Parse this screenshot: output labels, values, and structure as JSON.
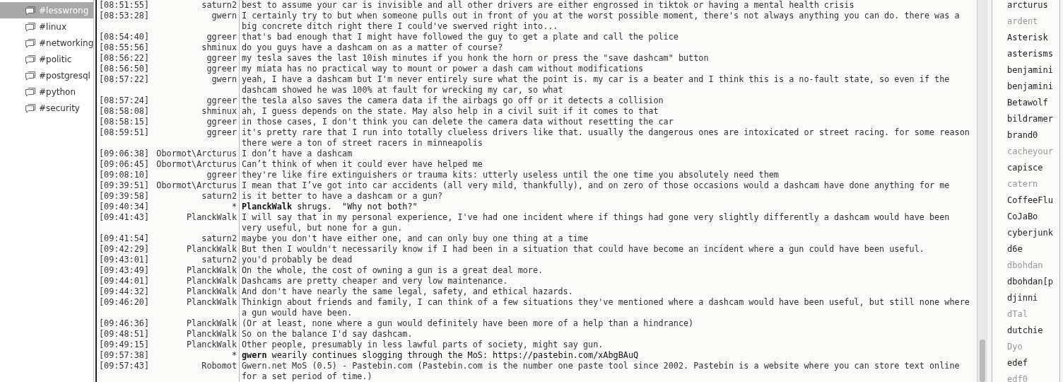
{
  "channels": [
    {
      "label": "#lesswrong",
      "selected": true
    },
    {
      "label": "#linux",
      "selected": false
    },
    {
      "label": "#networking",
      "selected": false
    },
    {
      "label": "#politic",
      "selected": false
    },
    {
      "label": "#postgresql",
      "selected": false
    },
    {
      "label": "#python",
      "selected": false
    },
    {
      "label": "#security",
      "selected": false
    }
  ],
  "messages": [
    {
      "kind": "message",
      "time": "[08:51:55]",
      "nick": "saturn2",
      "text": "best to assume your car is invisible and all other drivers are either engrossed in tiktok or having a mental health crisis"
    },
    {
      "kind": "message",
      "time": "[08:53:28]",
      "nick": "gwern",
      "text": "I certainly try to but when someone pulls out in front of you at the worst possible moment, there's not always anything you can do. there was a big concrete ditch right there I could've swerved right into..."
    },
    {
      "kind": "message",
      "time": "[08:54:40]",
      "nick": "ggreer",
      "text": "that's bad enough that I might have followed the guy to get a plate and call the police"
    },
    {
      "kind": "message",
      "time": "[08:55:56]",
      "nick": "shminux",
      "text": "do you guys have a dashcam on as a matter of course?"
    },
    {
      "kind": "message",
      "time": "[08:56:22]",
      "nick": "ggreer",
      "text": "my tesla saves the last 10ish minutes if you honk the horn or press the \"save dashcam\" button"
    },
    {
      "kind": "message",
      "time": "[08:56:50]",
      "nick": "ggreer",
      "text": "my miata has no practical way to mount or power a dash cam without modifications"
    },
    {
      "kind": "message",
      "time": "[08:57:22]",
      "nick": "gwern",
      "text": "yeah, I have a dashcam but I'm never entirely sure what the point is. my car is a beater and I think this is a no-fault state, so even if the dashcam showed he was 100% at fault for wrecking my car, so what"
    },
    {
      "kind": "message",
      "time": "[08:57:24]",
      "nick": "ggreer",
      "text": "the tesla also saves the camera data if the airbags go off or it detects a collision"
    },
    {
      "kind": "message",
      "time": "[08:58:08]",
      "nick": "shminux",
      "text": "ah, I guess depends on the state. May also help in a civil suit if it comes to that"
    },
    {
      "kind": "message",
      "time": "[08:58:15]",
      "nick": "ggreer",
      "text": "in those cases, I don't think you can delete the camera data without resetting the car"
    },
    {
      "kind": "message",
      "time": "[08:59:51]",
      "nick": "ggreer",
      "text": "it's pretty rare that I run into totally clueless drivers like that. usually the dangerous ones are intoxicated or street racing. for some reason there were a ton of street racers in minneapolis"
    },
    {
      "kind": "message",
      "time": "[09:06:38]",
      "nick": "Obormot\\Arcturus",
      "text": "I don’t have a dashcam"
    },
    {
      "kind": "message",
      "time": "[09:06:45]",
      "nick": "Obormot\\Arcturus",
      "text": "Can’t think of when it could ever have helped me"
    },
    {
      "kind": "message",
      "time": "[09:08:10]",
      "nick": "ggreer",
      "text": "they're like fire extinguishers or trauma kits: utterly useless until the one time you absolutely need them"
    },
    {
      "kind": "message",
      "time": "[09:39:51]",
      "nick": "Obormot\\Arcturus",
      "text": "I mean that I’ve got into car accidents (all very mild, thankfully), and on zero of those occasions would a dashcam have done anything for me"
    },
    {
      "kind": "message",
      "time": "[09:39:58]",
      "nick": "saturn2",
      "text": "is it better to have a dashcam or a gun?"
    },
    {
      "kind": "action",
      "time": "[09:40:34]",
      "nick": "*",
      "text": "**PlanckWalk** shrugs.  \"Why not both?\""
    },
    {
      "kind": "message",
      "time": "[09:41:43]",
      "nick": "PlanckWalk",
      "text": "I will say that in my personal experience, I've had one incident where if things had gone very slightly differently a dashcam would have been very useful, but none for a gun."
    },
    {
      "kind": "message",
      "time": "[09:41:54]",
      "nick": "saturn2",
      "text": "maybe you don't have either one, and can only buy one thing at a time"
    },
    {
      "kind": "message",
      "time": "[09:42:29]",
      "nick": "PlanckWalk",
      "text": "But then I wouldn't necessarily know if I had been in a situation that could have become an incident where a gun could have been useful."
    },
    {
      "kind": "message",
      "time": "[09:43:01]",
      "nick": "saturn2",
      "text": "you'd probably be dead"
    },
    {
      "kind": "message",
      "time": "[09:43:49]",
      "nick": "PlanckWalk",
      "text": "On the whole, the cost of owning a gun is a great deal more."
    },
    {
      "kind": "message",
      "time": "[09:44:01]",
      "nick": "PlanckWalk",
      "text": "Dashcams are pretty cheaper and very low maintenance."
    },
    {
      "kind": "message",
      "time": "[09:44:32]",
      "nick": "PlanckWalk",
      "text": "And don't have nearly the same legal, safety, and ethical hazards."
    },
    {
      "kind": "message",
      "time": "[09:46:20]",
      "nick": "PlanckWalk",
      "text": "Thinkign about friends and family, I can think of a few situations they've mentioned where a dashcam would have been useful, but still none where a gun would have been."
    },
    {
      "kind": "message",
      "time": "[09:46:36]",
      "nick": "PlanckWalk",
      "text": "(Or at least, none where a gun would definitely have been more of a help than a hindrance)"
    },
    {
      "kind": "message",
      "time": "[09:48:51]",
      "nick": "PlanckWalk",
      "text": "So on the balance I'd say dashcam."
    },
    {
      "kind": "message",
      "time": "[09:49:15]",
      "nick": "PlanckWalk",
      "text": "Other people, presumably in less lawful parts of society, might say gun."
    },
    {
      "kind": "action",
      "time": "[09:57:38]",
      "nick": "*",
      "text": "**gwern** wearily continues slogging through the MoS: https://pastebin.com/xAbgBAuQ"
    },
    {
      "kind": "message",
      "time": "[09:57:43]",
      "nick": "Robomot",
      "text": "Gwern.net MoS (0.5) - Pastebin.com (Pastebin.com is the number one paste tool since 2002. Pastebin is a website where you can store text online for a set period of time.)"
    }
  ],
  "users": [
    {
      "name": "arcturus",
      "away": false
    },
    {
      "name": "ardent",
      "away": true
    },
    {
      "name": "Asterisk",
      "away": false
    },
    {
      "name": "asterisms",
      "away": false
    },
    {
      "name": "benjamini",
      "away": false
    },
    {
      "name": "benjamini",
      "away": false
    },
    {
      "name": "Betawolf",
      "away": false
    },
    {
      "name": "bildramer",
      "away": false
    },
    {
      "name": "brand0",
      "away": false
    },
    {
      "name": "cacheyour",
      "away": true
    },
    {
      "name": "capisce",
      "away": false
    },
    {
      "name": "catern",
      "away": true
    },
    {
      "name": "CoffeeFlu",
      "away": false
    },
    {
      "name": "CoJaBo",
      "away": false
    },
    {
      "name": "cyberjunk",
      "away": false
    },
    {
      "name": "d6e",
      "away": false
    },
    {
      "name": "dbohdan",
      "away": true
    },
    {
      "name": "dbohdan[p",
      "away": false
    },
    {
      "name": "djinni",
      "away": false
    },
    {
      "name": "dTal",
      "away": true
    },
    {
      "name": "dutchie",
      "away": false
    },
    {
      "name": "Dyo",
      "away": true
    },
    {
      "name": "edef",
      "away": false
    },
    {
      "name": "edf0",
      "away": true
    }
  ]
}
